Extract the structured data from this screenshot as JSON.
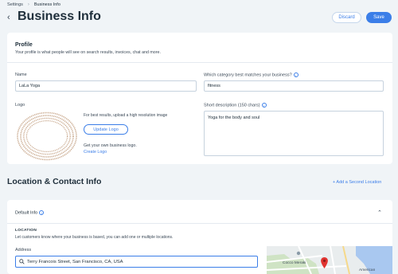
{
  "breadcrumb": {
    "parent": "Settings",
    "separator": "›",
    "current": "Business Info"
  },
  "header": {
    "title": "Business Info",
    "discard_label": "Discard",
    "save_label": "Save"
  },
  "profile": {
    "title": "Profile",
    "subtitle": "Your profile is what people will see on search results, invoices, chat and more.",
    "name_label": "Name",
    "name_value": "LaLa Yoga",
    "category_label": "Which category best matches your business?",
    "category_value": "fitness",
    "logo_label": "Logo",
    "logo_hint": "For best results, upload a high resolution image",
    "upload_label": "Update Logo",
    "logo_get": "Get your own business logo.",
    "logo_create": "Create Logo",
    "desc_label": "Short description (150 chars)",
    "desc_value": "Yoga for the body and soul"
  },
  "location": {
    "section_title": "Location & Contact Info",
    "add_label": "+ Add a Second Location",
    "default_info": "Default Info",
    "heading": "LOCATION",
    "subtitle": "Let customers know where your business is based, you can add one or multiple locations.",
    "address_label": "Address",
    "address_value": "Terry Francois Street, San Francisco, CA, USA",
    "map_label_1": "Cocco Meraki",
    "map_label_2": "American"
  },
  "colors": {
    "accent": "#3b7ee8",
    "background": "#f0f4f7",
    "card": "#ffffff",
    "pin": "#e0332f",
    "logo_ring": "#c9a98e"
  }
}
